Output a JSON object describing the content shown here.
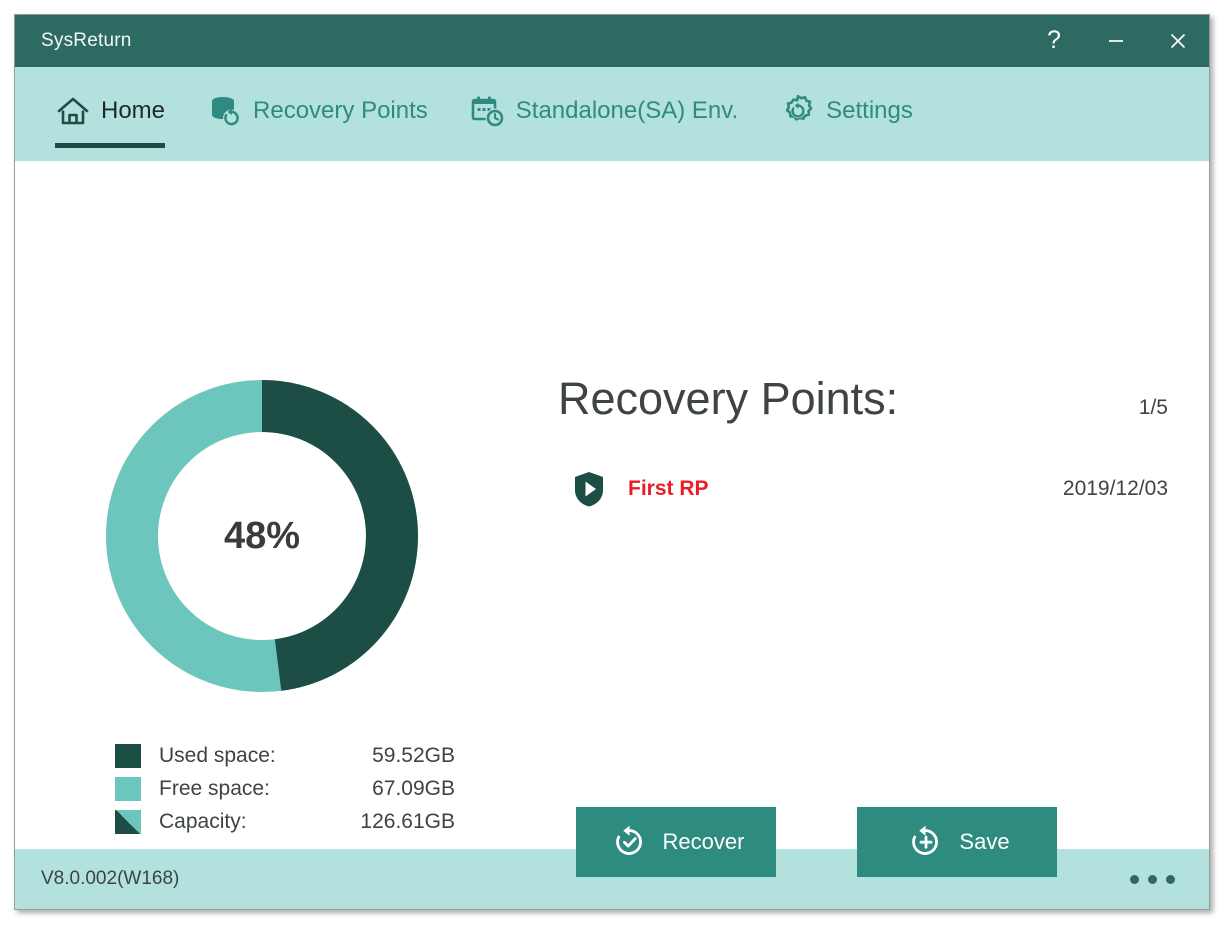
{
  "window": {
    "title": "SysReturn",
    "controls": {
      "help": "?",
      "minimize": "minimize-icon",
      "close": "close-icon"
    }
  },
  "nav": {
    "items": [
      {
        "label": "Home",
        "icon": "home-icon",
        "active": true
      },
      {
        "label": "Recovery Points",
        "icon": "database-restore-icon",
        "active": false
      },
      {
        "label": "Standalone(SA) Env.",
        "icon": "calendar-clock-icon",
        "active": false
      },
      {
        "label": "Settings",
        "icon": "gear-reset-icon",
        "active": false
      }
    ]
  },
  "disk": {
    "percent_label": "48%",
    "legend": [
      {
        "label": "Used space:",
        "value": "59.52GB",
        "swatch": "used"
      },
      {
        "label": "Free space:",
        "value": "67.09GB",
        "swatch": "free"
      },
      {
        "label": "Capacity:",
        "value": "126.61GB",
        "swatch": "capacity"
      }
    ]
  },
  "recovery_points": {
    "title": "Recovery Points:",
    "count": "1/5",
    "items": [
      {
        "name": "First RP",
        "date": "2019/12/03",
        "icon": "shield-play-icon"
      }
    ]
  },
  "actions": [
    {
      "label": "Recover",
      "icon": "restore-check-icon"
    },
    {
      "label": "Save",
      "icon": "restore-plus-icon"
    }
  ],
  "footer": {
    "version": "V8.0.002(W168)",
    "menu": "more-options-icon"
  },
  "chart_data": {
    "type": "pie",
    "title": "Disk usage",
    "categories": [
      "Used space",
      "Free space"
    ],
    "values": [
      59.52,
      67.09
    ],
    "units": "GB",
    "percentages": [
      48,
      52
    ],
    "colors": [
      "#1d4e46",
      "#6cc6bd"
    ],
    "center_label": "48%",
    "total": 126.61,
    "donut": true,
    "legend": "bottom"
  },
  "colors": {
    "titlebar": "#2d6b62",
    "navbar": "#b3e2de",
    "accent": "#2e8b80",
    "used": "#1d4e46",
    "free": "#6cc6bd",
    "alert": "#ec1c24"
  }
}
